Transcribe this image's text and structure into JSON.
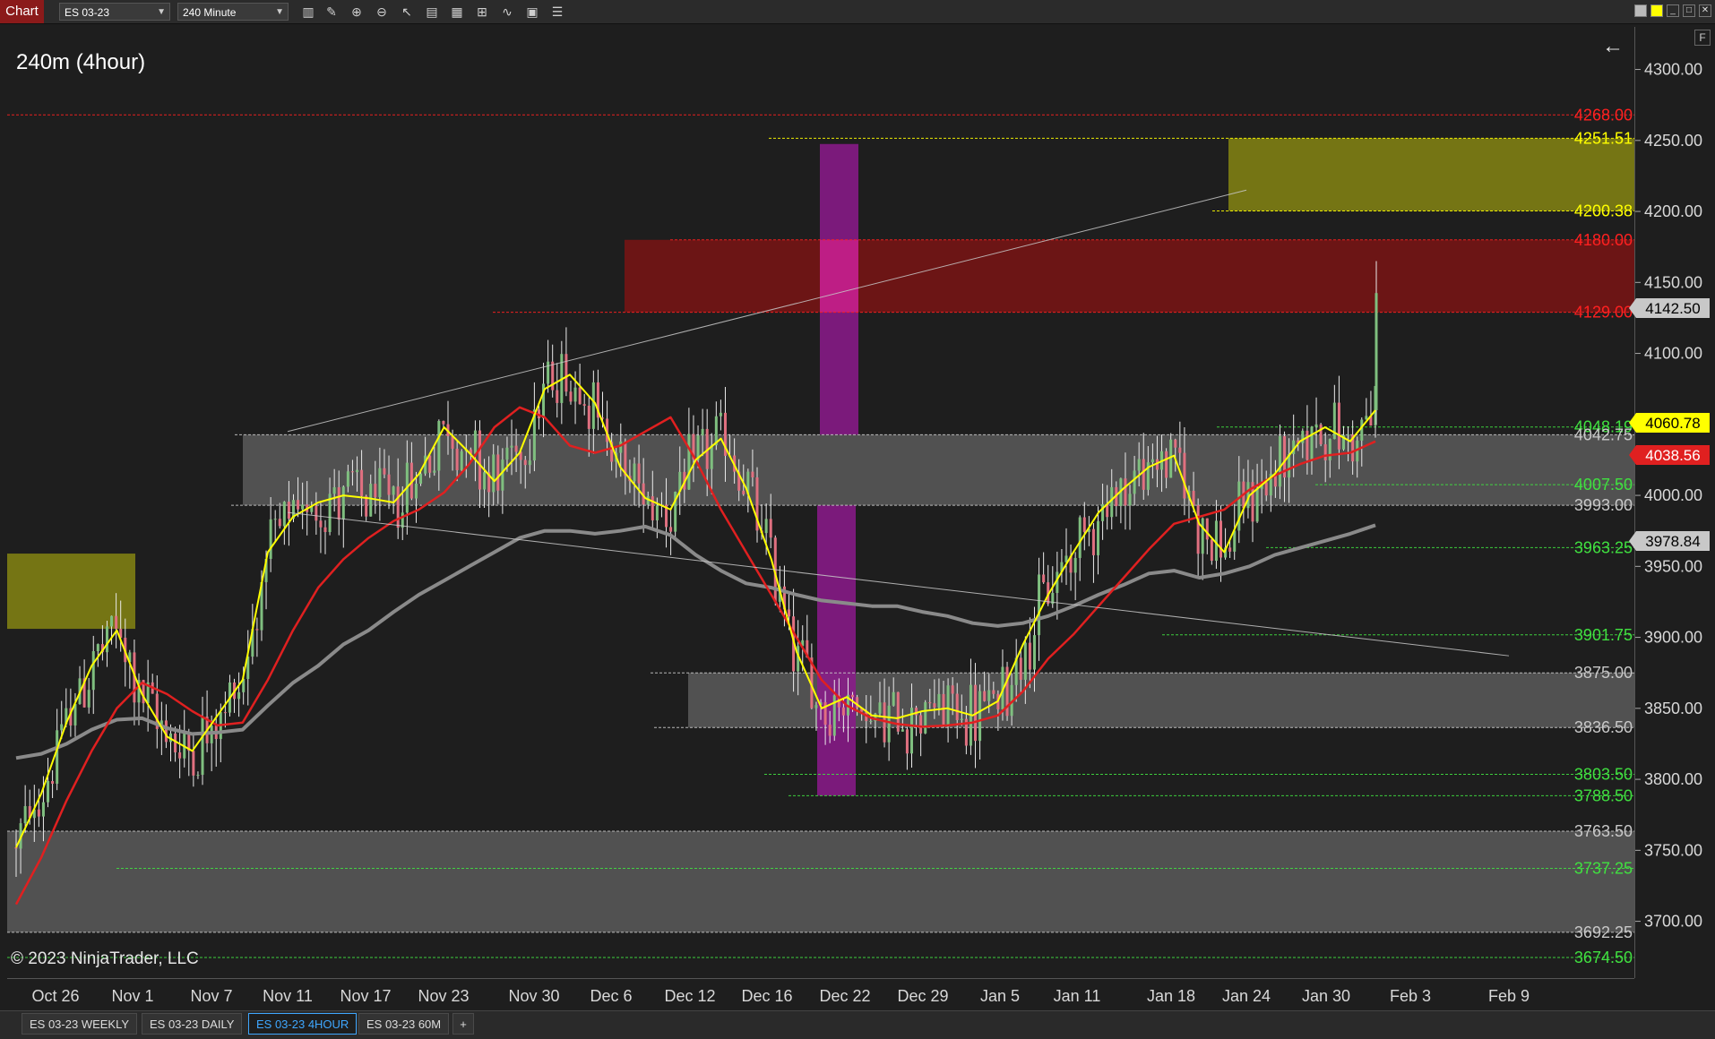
{
  "app": {
    "title": "Chart",
    "instrument": "ES 03-23",
    "interval": "240 Minute",
    "caption": "240m (4hour)",
    "copyright": "© 2023 NinjaTrader, LLC"
  },
  "toolbar_icons": [
    "bars-icon",
    "pencil-icon",
    "zoom-in-icon",
    "zoom-out-icon",
    "cursor-icon",
    "properties-icon",
    "templates-icon",
    "strategies-icon",
    "indicators-icon",
    "data-box-icon",
    "list-icon"
  ],
  "tabs": [
    {
      "label": "ES 03-23 WEEKLY",
      "active": false
    },
    {
      "label": "ES 03-23 DAILY",
      "active": false
    },
    {
      "label": "ES 03-23 4HOUR",
      "active": true
    },
    {
      "label": "ES 03-23 60M",
      "active": false
    },
    {
      "label": "+",
      "active": false
    }
  ],
  "colors": {
    "background": "#1e1e1e",
    "up_candle": "#7fbf7f",
    "down_candle": "#e07080",
    "ema_fast": "#ffff00",
    "ema_mid": "#e02020",
    "ema_slow": "#8a8a8a",
    "zone_gray": "#5a5a5a",
    "zone_red": "#7a1414",
    "zone_olive": "#7a7a14",
    "zone_purple": "#8c1a8c"
  },
  "chart_data": {
    "type": "candlestick",
    "price_axis": {
      "ylim": [
        3660,
        4330
      ],
      "ticks": [
        "4300.00",
        "4250.00",
        "4200.00",
        "4150.00",
        "4100.00",
        "4050.00",
        "4000.00",
        "3950.00",
        "3900.00",
        "3850.00",
        "3800.00",
        "3750.00",
        "3700.00"
      ]
    },
    "time_axis": {
      "labels": [
        "Oct 26",
        "Nov 1",
        "Nov 7",
        "Nov 11",
        "Nov 17",
        "Nov 23",
        "Nov 30",
        "Dec 6",
        "Dec 12",
        "Dec 16",
        "Dec 22",
        "Dec 29",
        "Jan 5",
        "Jan 11",
        "Jan 18",
        "Jan 24",
        "Jan 30",
        "Feb 3",
        "Feb 9"
      ]
    },
    "level_lines": [
      {
        "label": "4268.00",
        "price": 4268.0,
        "color": "#ff2020"
      },
      {
        "label": "4251.51",
        "price": 4251.51,
        "color": "#ffff00"
      },
      {
        "label": "4200.38",
        "price": 4200.38,
        "color": "#ffff00"
      },
      {
        "label": "4180.00",
        "price": 4180.0,
        "color": "#ff2020"
      },
      {
        "label": "4129.00",
        "price": 4129.0,
        "color": "#ff2020"
      },
      {
        "label": "4048.19",
        "price": 4048.19,
        "color": "#40e040"
      },
      {
        "label": "4042.75",
        "price": 4042.75,
        "color": "#c8c8c8"
      },
      {
        "label": "4007.50",
        "price": 4007.5,
        "color": "#40e040"
      },
      {
        "label": "3993.00",
        "price": 3993.0,
        "color": "#c8c8c8"
      },
      {
        "label": "3963.25",
        "price": 3963.25,
        "color": "#40e040"
      },
      {
        "label": "3901.75",
        "price": 3901.75,
        "color": "#40e040"
      },
      {
        "label": "3875.00",
        "price": 3875.0,
        "color": "#c8c8c8"
      },
      {
        "label": "3836.50",
        "price": 3836.5,
        "color": "#c8c8c8"
      },
      {
        "label": "3803.50",
        "price": 3803.5,
        "color": "#40e040"
      },
      {
        "label": "3788.50",
        "price": 3788.5,
        "color": "#40e040"
      },
      {
        "label": "3763.50",
        "price": 3763.5,
        "color": "#c8c8c8"
      },
      {
        "label": "3737.25",
        "price": 3737.25,
        "color": "#40e040"
      },
      {
        "label": "3692.25",
        "price": 3692.25,
        "color": "#c8c8c8"
      },
      {
        "label": "3674.50",
        "price": 3674.5,
        "color": "#40e040"
      }
    ],
    "price_markers": [
      {
        "label": "4142.50",
        "bg": "#c8c8c8",
        "fg": "#000000"
      },
      {
        "label": "4060.78",
        "bg": "#ffff00",
        "fg": "#000000"
      },
      {
        "label": "4038.56",
        "bg": "#e02020",
        "fg": "#ffffff"
      },
      {
        "label": "3978.84",
        "bg": "#c8c8c8",
        "fg": "#000000"
      }
    ],
    "zones": [
      {
        "kind": "gray",
        "from_price": 4042.75,
        "to_price": 3993.0
      },
      {
        "kind": "gray",
        "from_price": 3875.0,
        "to_price": 3836.5
      },
      {
        "kind": "gray",
        "from_price": 3763.5,
        "to_price": 3692.25
      },
      {
        "kind": "red",
        "from_price": 4180.0,
        "to_price": 4129.0
      },
      {
        "kind": "olive",
        "from_price": 4251.51,
        "to_price": 4200.38
      },
      {
        "kind": "olive",
        "from_price": 3959.0,
        "to_price": 3906.0
      },
      {
        "kind": "purple",
        "from_price": 4247.5,
        "to_price": 4042.75
      },
      {
        "kind": "purple",
        "from_price": 3993.0,
        "to_price": 3788.5
      }
    ],
    "ema_fast": [
      3752,
      3790,
      3840,
      3880,
      3905,
      3860,
      3830,
      3820,
      3845,
      3870,
      3960,
      3985,
      3995,
      4000,
      3998,
      3995,
      4015,
      4048,
      4030,
      4010,
      4030,
      4075,
      4085,
      4065,
      4020,
      3998,
      3990,
      4025,
      4040,
      4005,
      3955,
      3890,
      3850,
      3858,
      3845,
      3843,
      3848,
      3850,
      3845,
      3855,
      3895,
      3930,
      3960,
      3988,
      4005,
      4020,
      4028,
      3980,
      3960,
      4000,
      4015,
      4038,
      4048,
      4038,
      4060
    ],
    "ema_mid": [
      3712,
      3745,
      3785,
      3820,
      3850,
      3868,
      3860,
      3848,
      3838,
      3840,
      3870,
      3905,
      3935,
      3955,
      3970,
      3982,
      3990,
      4002,
      4022,
      4048,
      4062,
      4055,
      4035,
      4030,
      4035,
      4045,
      4055,
      4025,
      3990,
      3960,
      3930,
      3900,
      3870,
      3852,
      3843,
      3839,
      3837,
      3838,
      3840,
      3845,
      3862,
      3885,
      3902,
      3922,
      3942,
      3962,
      3980,
      3985,
      3990,
      4004,
      4014,
      4022,
      4028,
      4030,
      4038
    ],
    "ema_slow": [
      3815,
      3818,
      3825,
      3835,
      3842,
      3843,
      3836,
      3832,
      3833,
      3835,
      3852,
      3868,
      3880,
      3895,
      3905,
      3918,
      3930,
      3940,
      3950,
      3960,
      3970,
      3975,
      3975,
      3973,
      3975,
      3978,
      3972,
      3958,
      3947,
      3938,
      3935,
      3930,
      3926,
      3924,
      3922,
      3922,
      3918,
      3915,
      3910,
      3908,
      3910,
      3915,
      3922,
      3930,
      3937,
      3945,
      3947,
      3942,
      3945,
      3950,
      3958,
      3963,
      3968,
      3973,
      3979
    ],
    "trend_lines": [
      {
        "from": [
          "Nov 11",
          4045
        ],
        "to": [
          "Jan 24",
          4215
        ]
      },
      {
        "from": [
          "Nov 11",
          3988
        ],
        "to": [
          "Feb 9",
          3887
        ]
      }
    ]
  }
}
